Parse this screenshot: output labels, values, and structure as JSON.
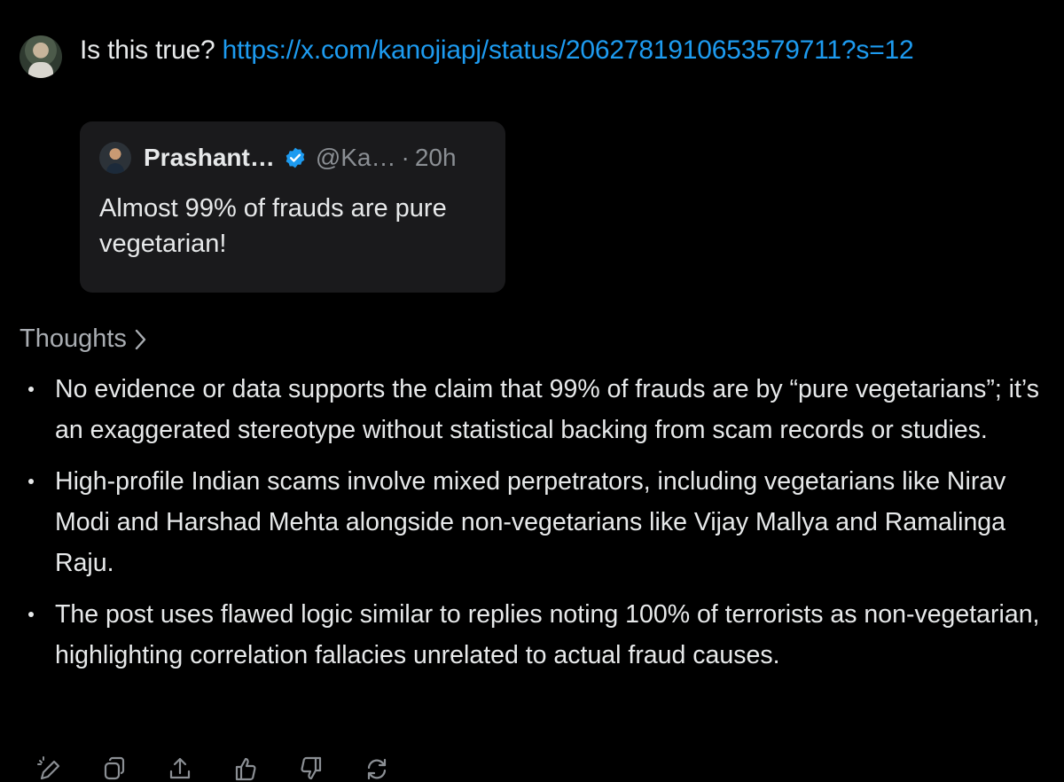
{
  "user_message": {
    "question": "Is this true?",
    "link": "https://x.com/kanojiapj/status/2062781910653579711?s=12"
  },
  "quoted_post": {
    "author_name": "Prashant…",
    "handle": "@Ka…",
    "separator": "·",
    "time": "20h",
    "text": "Almost 99% of frauds are pure vegetarian!"
  },
  "thoughts": {
    "label": "Thoughts"
  },
  "answer": {
    "bullets": [
      "No evidence or data supports the claim that 99% of frauds are by “pure vegetarians”; it’s an exaggerated stereotype without statistical backing from scam records or studies.",
      "High-profile Indian scams involve mixed perpetrators, including vegetarians like Nirav Modi and Harshad Mehta alongside non-vegetarians like Vijay Mallya and Ramalinga Raju.",
      "The post uses flawed logic similar to replies noting 100% of terrorists as non-vegetarian, highlighting correlation fallacies unrelated to actual fraud causes."
    ]
  },
  "actions": [
    {
      "icon": "edit-icon"
    },
    {
      "icon": "copy-icon"
    },
    {
      "icon": "share-icon"
    },
    {
      "icon": "thumbs-up-icon"
    },
    {
      "icon": "thumbs-down-icon"
    },
    {
      "icon": "regenerate-icon"
    }
  ],
  "colors": {
    "background": "#000000",
    "text": "#e7e9ea",
    "link": "#1d9bf0",
    "muted": "#8b8f94",
    "card": "#1a1a1c",
    "verified": "#1d9bf0"
  }
}
